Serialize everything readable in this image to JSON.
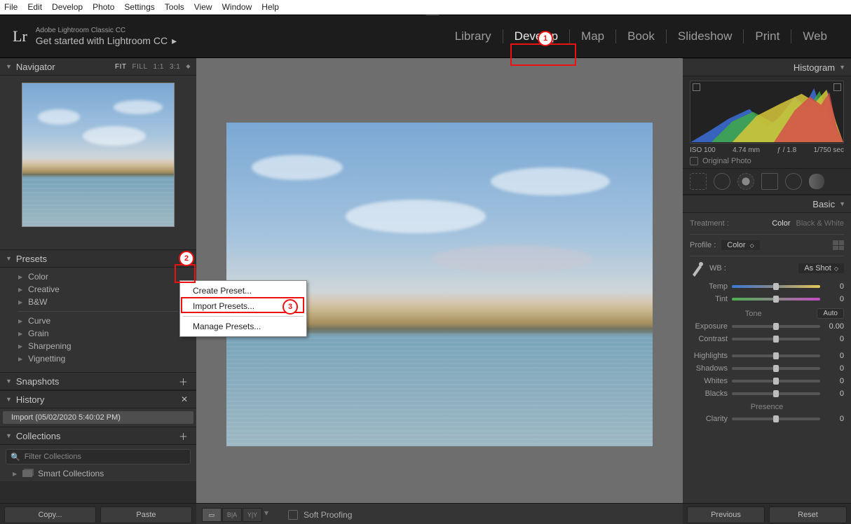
{
  "os_menu": [
    "File",
    "Edit",
    "Develop",
    "Photo",
    "Settings",
    "Tools",
    "View",
    "Window",
    "Help"
  ],
  "header": {
    "product_sub": "Adobe Lightroom Classic CC",
    "product_main": "Get started with Lightroom CC",
    "logo": "Lr",
    "modules": [
      {
        "label": "Library",
        "active": false
      },
      {
        "label": "Develop",
        "active": true
      },
      {
        "label": "Map",
        "active": false
      },
      {
        "label": "Book",
        "active": false
      },
      {
        "label": "Slideshow",
        "active": false
      },
      {
        "label": "Print",
        "active": false
      },
      {
        "label": "Web",
        "active": false
      }
    ]
  },
  "left": {
    "navigator": {
      "title": "Navigator",
      "zoom": [
        "FIT",
        "FILL",
        "1:1",
        "3:1"
      ],
      "zoom_active": "FIT"
    },
    "presets": {
      "title": "Presets",
      "groups_a": [
        "Color",
        "Creative",
        "B&W"
      ],
      "groups_b": [
        "Curve",
        "Grain",
        "Sharpening",
        "Vignetting"
      ]
    },
    "snapshots": {
      "title": "Snapshots"
    },
    "history": {
      "title": "History",
      "entry": "Import (05/02/2020 5:40:02 PM)"
    },
    "collections": {
      "title": "Collections",
      "filter_placeholder": "Filter Collections",
      "smart": "Smart Collections"
    },
    "footer": {
      "copy": "Copy...",
      "paste": "Paste"
    }
  },
  "context_menu": {
    "items": [
      "Create Preset...",
      "Import Presets...",
      "Manage Presets..."
    ],
    "highlighted": 1
  },
  "center_footer": {
    "soft_proof": "Soft Proofing"
  },
  "right": {
    "histogram": {
      "title": "Histogram",
      "meta": [
        "ISO 100",
        "4.74 mm",
        "ƒ / 1.8",
        "1/750 sec"
      ],
      "original": "Original Photo"
    },
    "basic": {
      "title": "Basic",
      "treatment_label": "Treatment :",
      "treatment_opts": [
        "Color",
        "Black & White"
      ],
      "profile_label": "Profile :",
      "profile_value": "Color",
      "wb_label": "WB :",
      "wb_value": "As Shot",
      "tone_label": "Tone",
      "auto": "Auto",
      "presence_label": "Presence",
      "sliders_wb": [
        {
          "name": "Temp",
          "val": "0"
        },
        {
          "name": "Tint",
          "val": "0"
        }
      ],
      "sliders_tone": [
        {
          "name": "Exposure",
          "val": "0.00"
        },
        {
          "name": "Contrast",
          "val": "0"
        }
      ],
      "sliders_tone2": [
        {
          "name": "Highlights",
          "val": "0"
        },
        {
          "name": "Shadows",
          "val": "0"
        },
        {
          "name": "Whites",
          "val": "0"
        },
        {
          "name": "Blacks",
          "val": "0"
        }
      ],
      "sliders_presence": [
        {
          "name": "Clarity",
          "val": "0"
        }
      ]
    },
    "footer": {
      "prev": "Previous",
      "reset": "Reset"
    }
  },
  "callouts": {
    "one": "1",
    "two": "2",
    "three": "3"
  }
}
